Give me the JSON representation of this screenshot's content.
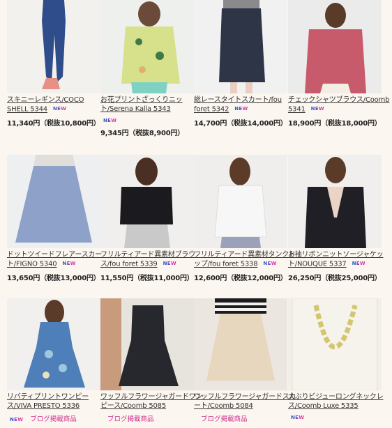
{
  "new_badge": {
    "n": "N",
    "e": "E",
    "w": "W"
  },
  "products": [
    {
      "name1": "スキニーレギンス/COCO",
      "name2": "SHELL 5344",
      "price": "11,340円（税抜10,800円）",
      "colors": {
        "bg": "#f3f1ee",
        "main": "#2f4d8a",
        "accent": "#e88f86"
      }
    },
    {
      "name1": "お花プリントざっくりニッ",
      "name2": "ト/Serena Kalla 5343",
      "price": "9,345円（税抜8,900円）",
      "colors": {
        "bg": "#eef0ee",
        "main": "#d7e08a",
        "accent": "#7fd1c4"
      }
    },
    {
      "name1": "総レースタイトスカート/fou",
      "name2": "foret 5342",
      "price": "14,700円（税抜14,000円）",
      "colors": {
        "bg": "#f1f1f2",
        "main": "#2d3547",
        "accent": "#8a8a8a"
      }
    },
    {
      "name1": "チェックシャツブラウス/Coomb",
      "name2": "5341",
      "price": "18,900円（税抜18,000円）",
      "colors": {
        "bg": "#ecebeb",
        "main": "#c75a6b",
        "accent": "#f3ede5"
      }
    },
    {
      "name1": "ドットツイードフレアースカー",
      "name2": "ト/FIGNO 5340",
      "price": "13,650円（税抜13,000円）",
      "colors": {
        "bg": "#eeeff1",
        "main": "#8ea2c9",
        "accent": "#e0ded9"
      }
    },
    {
      "name1": "フリルティアード異素材ブラウ",
      "name2": "ス/fou foret 5339",
      "price": "11,550円（税抜11,000円）",
      "colors": {
        "bg": "#f0efee",
        "main": "#1b1b1f",
        "accent": "#c9c9c9"
      }
    },
    {
      "name1": "フリルティアード異素材タンクト",
      "name2": "ップ/fou foret 5338",
      "price": "12,600円（税抜12,000円）",
      "colors": {
        "bg": "#efeeec",
        "main": "#f7f7f7",
        "accent": "#9aa1b8"
      }
    },
    {
      "name1": "お袖リボンニットソージャケッ",
      "name2": "ト/NOUQUE 5337",
      "price": "26,250円（税抜25,000円）",
      "colors": {
        "bg": "#f0efed",
        "main": "#1f1f25",
        "accent": "#e9d4c6"
      }
    },
    {
      "name1": "リバティプリントワンピー",
      "name2": "ス/VIVA PRESTO 5336",
      "blog": "ブログ掲載商品",
      "colors": {
        "bg": "#f1f0ee",
        "main": "#4f7fb8",
        "accent": "#9ec7dd"
      }
    },
    {
      "name1": "ワッフルフラワージャガードワン",
      "name2": "ピース/Coomb 5085",
      "blog": "ブログ掲載商品",
      "colors": {
        "bg": "#e7e3dd",
        "main": "#27282d",
        "accent": "#c79b7b"
      }
    },
    {
      "name1": "ワッフルフラワージャガードスカ",
      "name2": "ート/Coomb 5084",
      "blog": "ブログ掲載商品",
      "colors": {
        "bg": "#ebe6df",
        "main": "#e8d7bf",
        "accent": "#1c1c1c"
      }
    },
    {
      "name1": "大ぶりビジューロングネックレ",
      "name2": "ス/Coomb Luxe 5335",
      "colors": {
        "bg": "#f3efe8",
        "main": "#f6f2ec",
        "accent": "#d3c66f"
      }
    }
  ]
}
